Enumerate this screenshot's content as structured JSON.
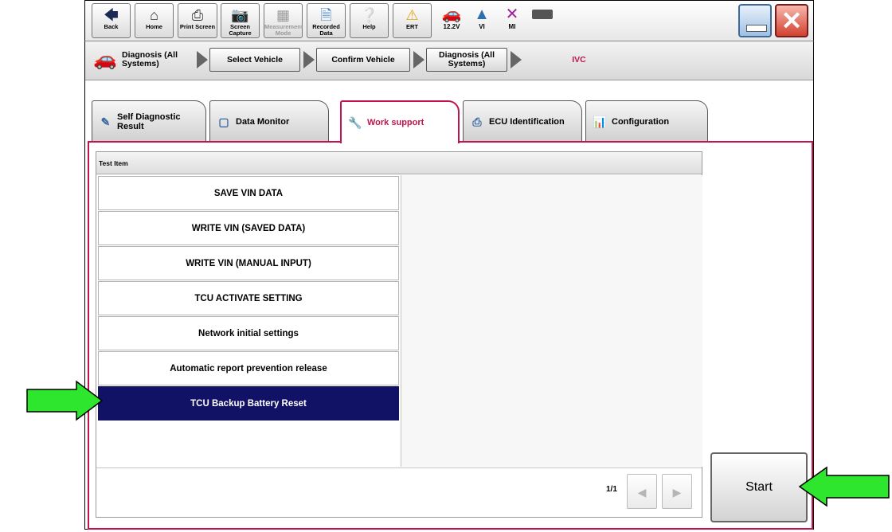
{
  "toolbar": {
    "buttons": [
      {
        "label": "Back",
        "icon": "back-arrow-icon"
      },
      {
        "label": "Home",
        "icon": "home-icon"
      },
      {
        "label": "Print Screen",
        "icon": "printer-icon"
      },
      {
        "label": "Screen Capture",
        "icon": "camera-icon"
      },
      {
        "label": "Measurement Mode",
        "icon": "measurement-icon"
      },
      {
        "label": "Recorded Data",
        "icon": "recorded-data-icon"
      },
      {
        "label": "Help",
        "icon": "help-icon"
      },
      {
        "label": "ERT",
        "icon": "warning-icon"
      }
    ],
    "status": [
      {
        "label": "12.2V",
        "icon": "car-battery-icon"
      },
      {
        "label": "VI",
        "icon": "signal-icon"
      },
      {
        "label": "MI",
        "icon": "x-icon"
      },
      {
        "label": "",
        "icon": "battery-indicator-icon"
      }
    ]
  },
  "breadcrumb": {
    "section": "Diagnosis (All Systems)",
    "steps": [
      "Select Vehicle",
      "Confirm Vehicle",
      "Diagnosis (All Systems)"
    ],
    "current": "IVC"
  },
  "tabs": [
    {
      "label": "Self Diagnostic Result",
      "active": false
    },
    {
      "label": "Data Monitor",
      "active": false
    },
    {
      "label": "Work support",
      "active": true
    },
    {
      "label": "ECU Identification",
      "active": false
    },
    {
      "label": "Configuration",
      "active": false
    }
  ],
  "list": {
    "header": "Test Item",
    "items": [
      "SAVE VIN DATA",
      "WRITE VIN (SAVED DATA)",
      "WRITE VIN (MANUAL INPUT)",
      "TCU ACTIVATE SETTING",
      "Network initial settings",
      "Automatic report prevention release",
      "TCU Backup Battery Reset"
    ],
    "selected": "TCU Backup Battery Reset",
    "page": "1/1"
  },
  "start_label": "Start",
  "colors": {
    "accent": "#c0154a",
    "selected_row": "#111166",
    "arrow_green": "#2ee62e"
  }
}
